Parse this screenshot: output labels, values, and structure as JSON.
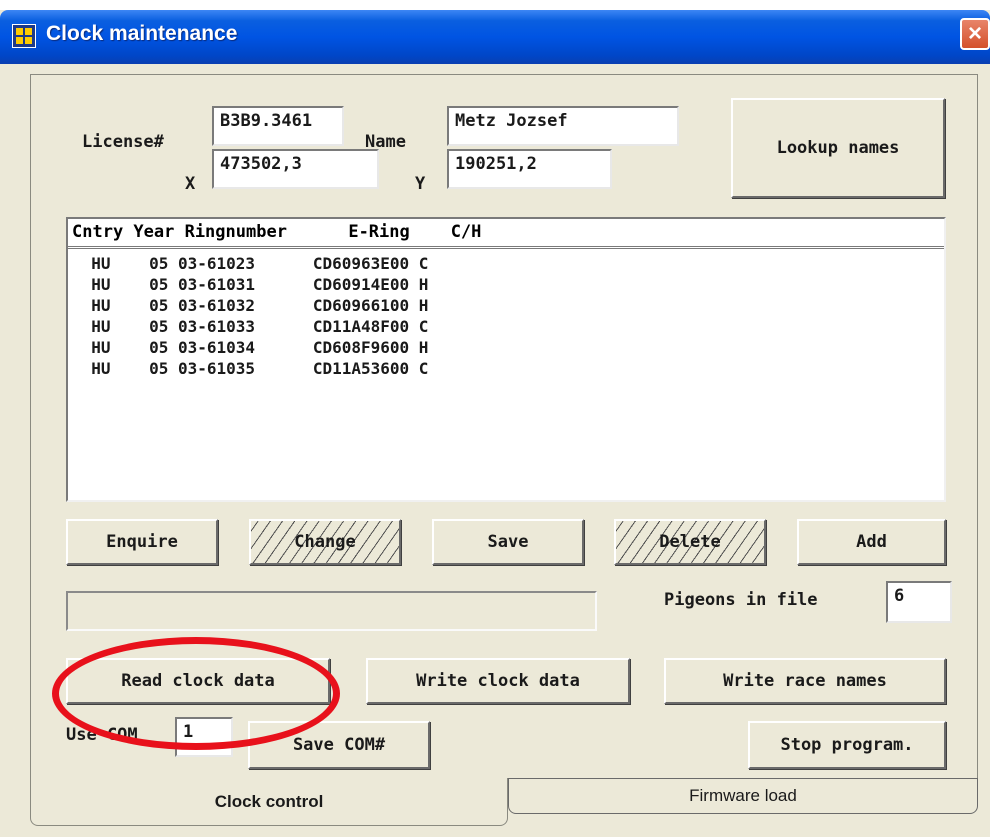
{
  "window": {
    "title": "Clock maintenance",
    "close_glyph": "×"
  },
  "fields": {
    "license_label": "License#",
    "license_value": "B3B9.3461",
    "name_label": "Name",
    "name_value": "Metz Jozsef",
    "x_label": "X",
    "x_value": "473502,3",
    "y_label": "Y",
    "y_value": "190251,2"
  },
  "buttons": {
    "lookup_names": "Lookup names",
    "enquire": "Enquire",
    "change": "Change",
    "save": "Save",
    "delete": "Delete",
    "add": "Add",
    "read_clock_data": "Read clock data",
    "write_clock_data": "Write clock data",
    "write_race_names": "Write race names",
    "save_com": "Save COM#",
    "stop_program": "Stop program."
  },
  "list": {
    "header": "Cntry Year Ringnumber      E-Ring    C/H",
    "columns": [
      "Cntry",
      "Year",
      "Ringnumber",
      "E-Ring",
      "C/H"
    ],
    "rows": [
      "  HU    05 03-61023      CD60963E00 C",
      "  HU    05 03-61031      CD60914E00 H",
      "  HU    05 03-61032      CD60966100 H",
      "  HU    05 03-61033      CD11A48F00 C",
      "  HU    05 03-61034      CD608F9600 H",
      "  HU    05 03-61035      CD11A53600 C"
    ]
  },
  "status_text": "",
  "pigeons": {
    "label": "Pigeons in file",
    "value": "6"
  },
  "com": {
    "label": "Use COM",
    "value": "1"
  },
  "tabs": {
    "active": "Clock control",
    "inactive": "Firmware load"
  },
  "colors": {
    "titlebar": "#0054e3",
    "window_bg": "#ece9d8",
    "highlight_ellipse": "#e8111b"
  }
}
